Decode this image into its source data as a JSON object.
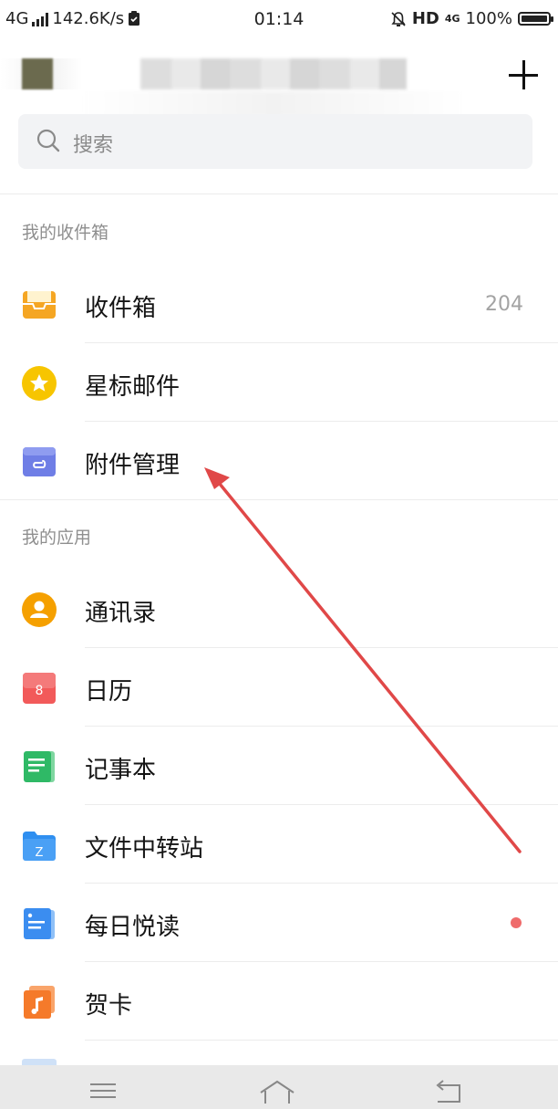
{
  "status_bar": {
    "network": "4G",
    "speed": "142.6K/s",
    "time": "01:14",
    "hd": "HD",
    "net2": "4G",
    "battery": "100%"
  },
  "search": {
    "placeholder": "搜索"
  },
  "sections": {
    "mailbox": "我的收件箱",
    "apps": "我的应用"
  },
  "mailbox_items": [
    {
      "label": "收件箱",
      "count": "204",
      "icon": "inbox-icon"
    },
    {
      "label": "星标邮件",
      "icon": "star-icon"
    },
    {
      "label": "附件管理",
      "icon": "attachment-icon"
    }
  ],
  "app_items": [
    {
      "label": "通讯录",
      "icon": "contacts-icon"
    },
    {
      "label": "日历",
      "icon": "calendar-icon",
      "badge": "8"
    },
    {
      "label": "记事本",
      "icon": "notepad-icon"
    },
    {
      "label": "文件中转站",
      "icon": "folder-icon",
      "badge": "Z"
    },
    {
      "label": "每日悦读",
      "icon": "reading-icon",
      "has_dot": true
    },
    {
      "label": "贺卡",
      "icon": "music-card-icon"
    }
  ],
  "colors": {
    "inbox": "#f5a623",
    "star": "#f7c500",
    "attachment": "#6f7ee6",
    "contacts": "#f5a000",
    "calendar": "#f25a5a",
    "notepad": "#2fb966",
    "folder": "#2f8ff0",
    "reading": "#3b8df0",
    "card": "#f57a2a",
    "arrow": "#e04848"
  }
}
